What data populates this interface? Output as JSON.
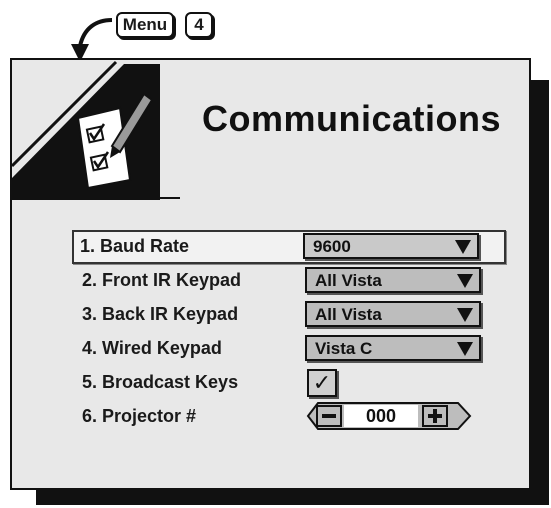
{
  "nav_hint": {
    "menu_key": "Menu",
    "number_key": "4"
  },
  "panel": {
    "title": "Communications",
    "icon": "checklist-pen-icon"
  },
  "items": [
    {
      "label": "1. Baud Rate",
      "control": "dropdown",
      "value": "9600",
      "selected": true
    },
    {
      "label": "2. Front IR Keypad",
      "control": "dropdown",
      "value": "All Vista"
    },
    {
      "label": "3. Back IR Keypad",
      "control": "dropdown",
      "value": "All Vista"
    },
    {
      "label": "4. Wired Keypad",
      "control": "dropdown",
      "value": "Vista C"
    },
    {
      "label": "5. Broadcast Keys",
      "control": "checkbox",
      "checked": true,
      "check_glyph": "✓"
    },
    {
      "label": "6. Projector #",
      "control": "stepper",
      "value": "000"
    }
  ],
  "colors": {
    "panel_background": "#e8e8e8",
    "control_fill": "#bdbdbd",
    "outline": "#111111"
  }
}
